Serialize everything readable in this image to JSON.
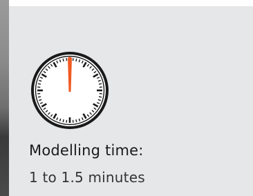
{
  "info_card": {
    "icon": "stopwatch-icon",
    "accent_color": "#f15a22",
    "background_color": "#e6e7e9",
    "heading": "Modelling time:",
    "value": "1 to 1.5 minutes"
  }
}
